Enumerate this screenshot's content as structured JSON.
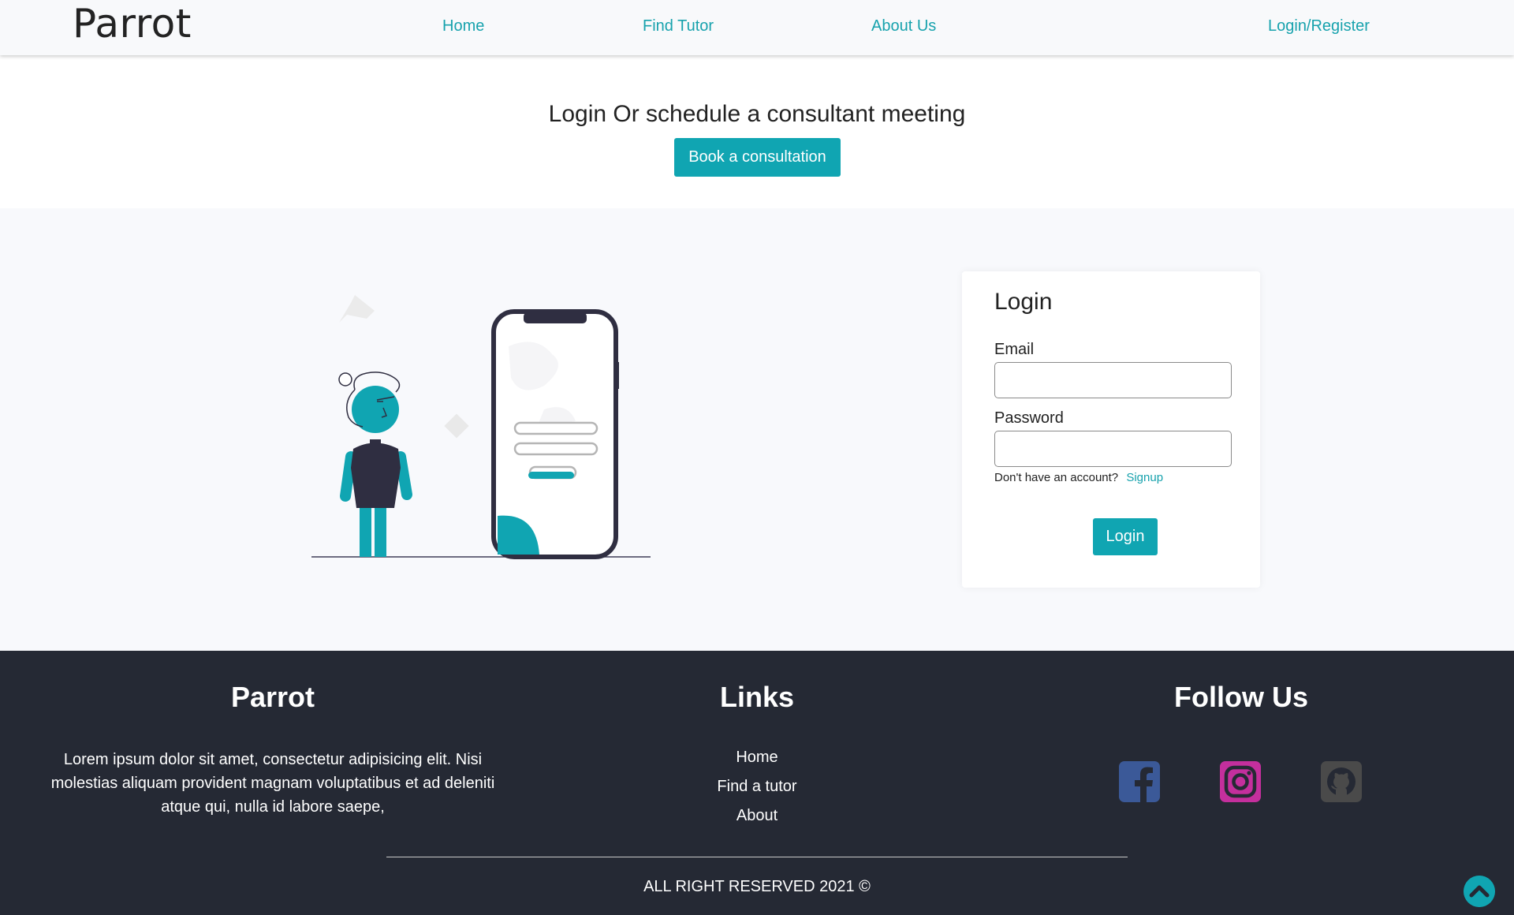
{
  "navbar": {
    "brand": "Parrot",
    "links": [
      "Home",
      "Find Tutor",
      "About Us",
      "Login/Register"
    ]
  },
  "hero": {
    "title": "Login Or schedule a consultant meeting",
    "button_label": "Book a consultation"
  },
  "login_card": {
    "title": "Login",
    "email_label": "Email",
    "email_value": "",
    "password_label": "Password",
    "password_value": "",
    "signup_prompt": "Don't have an account?",
    "signup_link": "Signup",
    "login_button": "Login"
  },
  "footer": {
    "brand_heading": "Parrot",
    "about_text": "Lorem ipsum dolor sit amet, consectetur adipisicing elit. Nisi molestias aliquam provident magnam voluptatibus et ad deleniti atque qui, nulla id labore saepe,",
    "links_heading": "Links",
    "links": [
      "Home",
      "Find a tutor",
      "About"
    ],
    "follow_heading": "Follow Us",
    "social": [
      {
        "name": "facebook-icon",
        "color": "#3b5998"
      },
      {
        "name": "instagram-icon",
        "color": "#c42f9d"
      },
      {
        "name": "github-icon",
        "color": "#4a4a4a"
      }
    ],
    "copyright": "ALL RIGHT RESERVED 2021 ©"
  },
  "colors": {
    "accent": "#10a5b2",
    "link": "#17a2ad",
    "footer_bg": "#252934",
    "illustration_dark": "#2f2e41"
  }
}
